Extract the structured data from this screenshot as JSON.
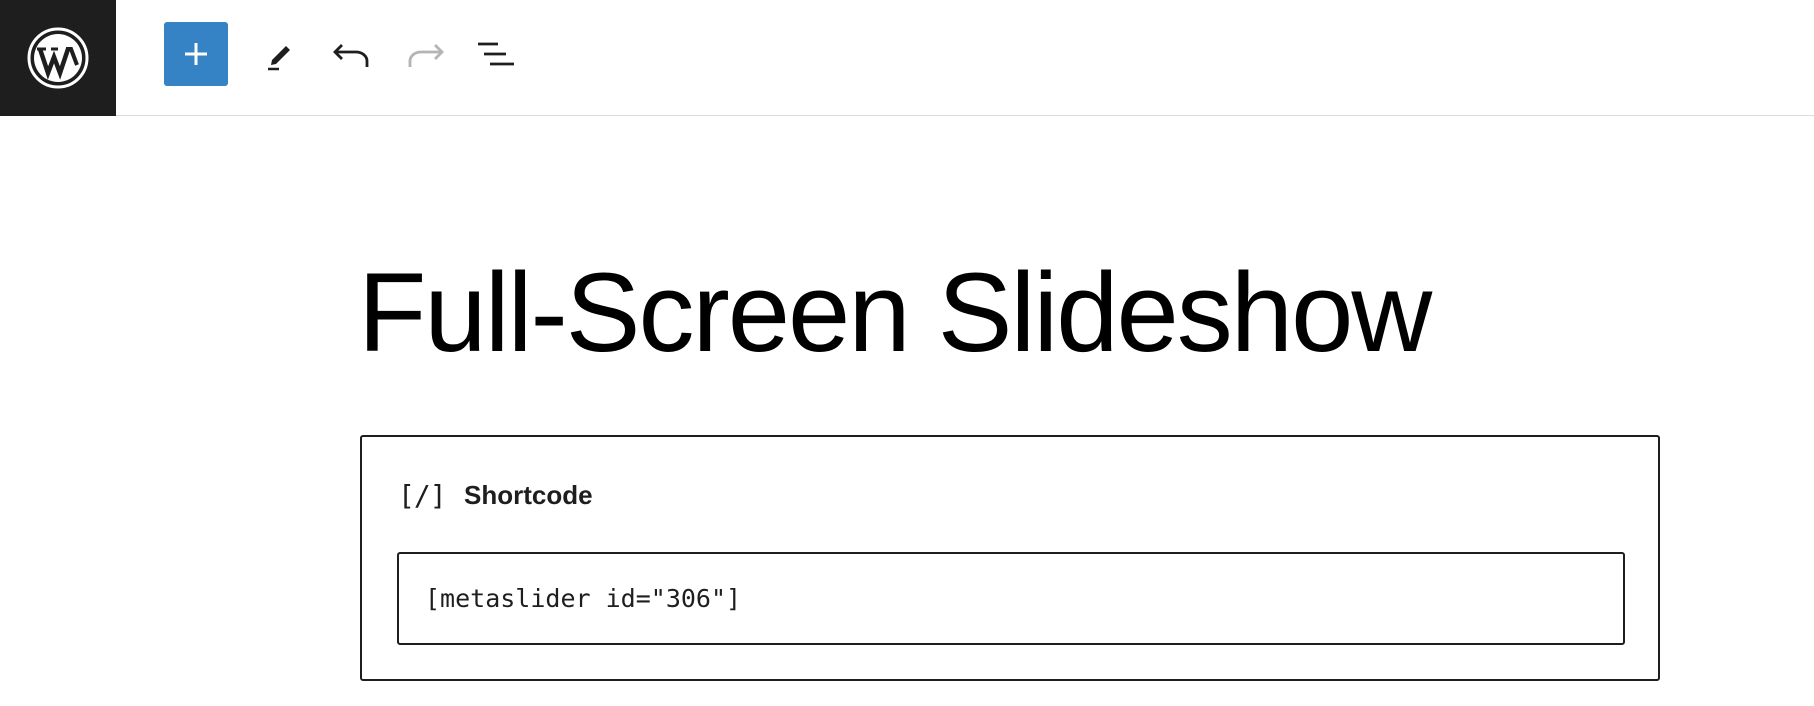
{
  "toolbar": {
    "logo_icon": "wordpress-logo-icon",
    "inserter_icon": "plus-icon",
    "edit_icon": "pencil-icon",
    "undo_icon": "undo-icon",
    "redo_icon": "redo-icon",
    "outline_icon": "list-view-icon",
    "accent_color": "#3582c4",
    "redo_disabled": true
  },
  "post": {
    "title": "Full-Screen Slideshow"
  },
  "shortcode_block": {
    "icon_text": "[/]",
    "label": "Shortcode",
    "value": "[metaslider id=\"306\"]"
  }
}
